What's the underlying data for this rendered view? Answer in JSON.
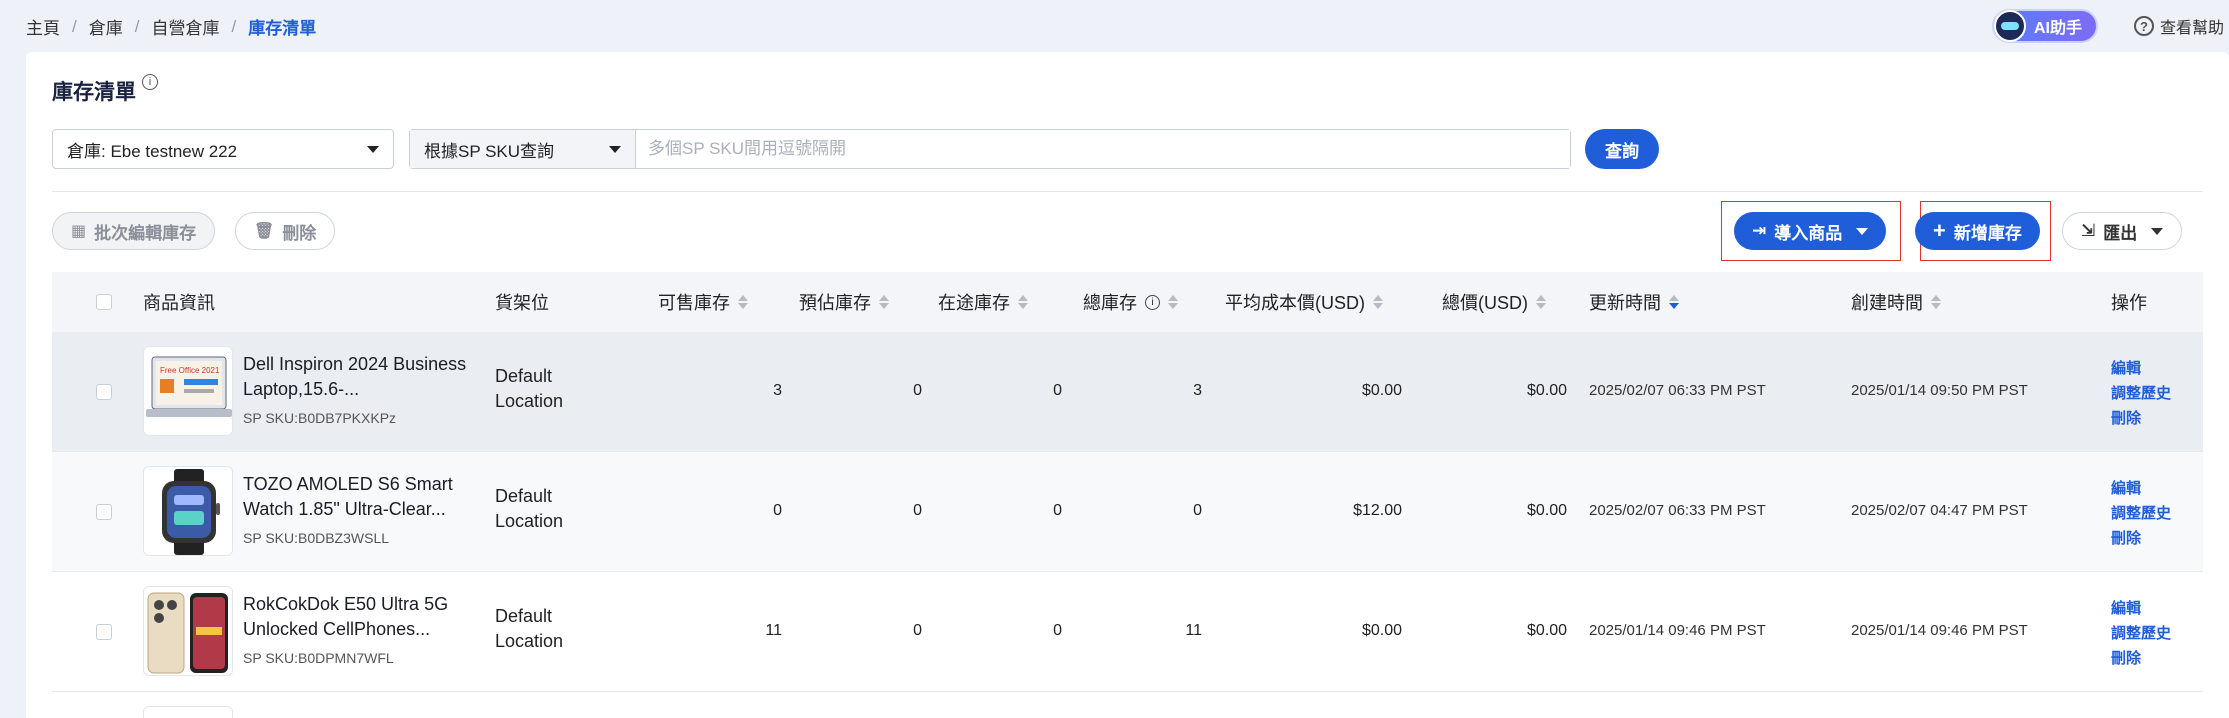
{
  "breadcrumb": [
    "主頁",
    "倉庫",
    "自營倉庫",
    "庫存清單"
  ],
  "header": {
    "ai_label": "AI助手",
    "help_label": "查看幫助"
  },
  "page": {
    "title": "庫存清單"
  },
  "filters": {
    "warehouse": "倉庫: Ebe testnew 222",
    "search_type": "根據SP SKU查詢",
    "search_placeholder": "多個SP SKU間用逗號隔開",
    "query_label": "查詢"
  },
  "toolbar": {
    "batch_edit": "批次編輯庫存",
    "delete": "刪除",
    "import": "導入商品",
    "add": "新增庫存",
    "export": "匯出"
  },
  "table": {
    "columns": {
      "product": "商品資訊",
      "location": "貨架位",
      "available": "可售庫存",
      "estimated": "預佔庫存",
      "transit": "在途庫存",
      "total": "總庫存",
      "avg_cost": "平均成本價(USD)",
      "total_value": "總價(USD)",
      "updated": "更新時間",
      "created": "創建時間",
      "actions": "操作"
    },
    "actions": [
      "編輯",
      "調整歷史",
      "刪除"
    ],
    "rows": [
      {
        "name": "Dell Inspiron 2024 Business Laptop,15.6-...",
        "sku": "SP SKU:B0DB7PKXKPz",
        "location": "Default Location",
        "available": "3",
        "estimated": "0",
        "transit": "0",
        "total": "3",
        "avg_cost": "$0.00",
        "total_value": "$0.00",
        "updated": "2025/02/07 06:33 PM PST",
        "created": "2025/01/14 09:50 PM PST",
        "thumb_text": "Free Office 2021"
      },
      {
        "name": "TOZO AMOLED S6 Smart Watch 1.85\" Ultra-Clear...",
        "sku": "SP SKU:B0DBZ3WSLL",
        "location": "Default Location",
        "available": "0",
        "estimated": "0",
        "transit": "0",
        "total": "0",
        "avg_cost": "$12.00",
        "total_value": "$0.00",
        "updated": "2025/02/07 06:33 PM PST",
        "created": "2025/02/07 04:47 PM PST"
      },
      {
        "name": "RokCokDok E50 Ultra 5G Unlocked CellPhones...",
        "sku": "SP SKU:B0DPMN7WFL",
        "location": "Default Location",
        "available": "11",
        "estimated": "0",
        "transit": "0",
        "total": "11",
        "avg_cost": "$0.00",
        "total_value": "$0.00",
        "updated": "2025/01/14 09:46 PM PST",
        "created": "2025/01/14 09:46 PM PST"
      }
    ]
  },
  "colors": {
    "primary": "#1f5ed8",
    "highlight": "#e0342f"
  }
}
